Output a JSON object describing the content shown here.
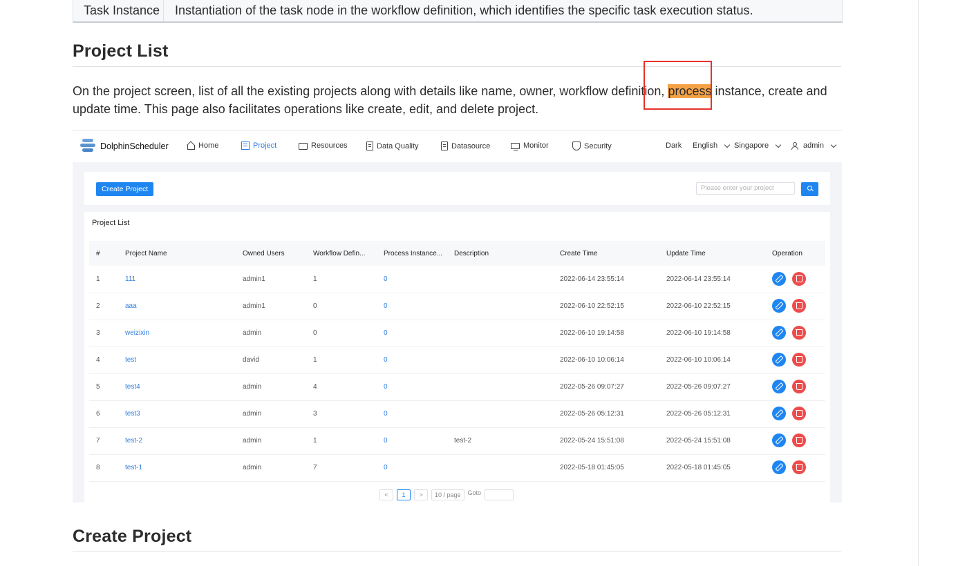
{
  "doc": {
    "task_row": {
      "term": "Task Instance",
      "definition": "Instantiation of the task node in the workflow definition, which identifies the specific task execution status."
    },
    "section1_title": "Project List",
    "para_before": "On the project screen, list of all the existing projects along with details like name, owner, workflow definition, ",
    "para_highlight": "process",
    "para_after": " instance, create and update time. This page also facilitates operations like create, edit, and delete project.",
    "section2_title": "Create Project"
  },
  "app": {
    "brand": "DolphinScheduler",
    "nav": [
      "Home",
      "Project",
      "Resources",
      "Data Quality",
      "Datasource",
      "Monitor",
      "Security"
    ],
    "active_nav": "Project",
    "theme": "Dark",
    "language": "English",
    "timezone": "Singapore",
    "user": "admin",
    "create_button": "Create Project",
    "search_placeholder": "Please enter your project",
    "list_title": "Project List",
    "columns": [
      "#",
      "Project Name",
      "Owned Users",
      "Workflow Defin...",
      "Process Instance...",
      "Description",
      "Create Time",
      "Update Time",
      "Operation"
    ],
    "rows": [
      {
        "idx": "1",
        "name": "111",
        "owner": "admin1",
        "workflows": "1",
        "instances": "0",
        "description": "",
        "create": "2022-06-14 23:55:14",
        "update": "2022-06-14 23:55:14"
      },
      {
        "idx": "2",
        "name": "aaa",
        "owner": "admin1",
        "workflows": "0",
        "instances": "0",
        "description": "",
        "create": "2022-06-10 22:52:15",
        "update": "2022-06-10 22:52:15"
      },
      {
        "idx": "3",
        "name": "weizixin",
        "owner": "admin",
        "workflows": "0",
        "instances": "0",
        "description": "",
        "create": "2022-06-10 19:14:58",
        "update": "2022-06-10 19:14:58"
      },
      {
        "idx": "4",
        "name": "test",
        "owner": "david",
        "workflows": "1",
        "instances": "0",
        "description": "",
        "create": "2022-06-10 10:06:14",
        "update": "2022-06-10 10:06:14"
      },
      {
        "idx": "5",
        "name": "test4",
        "owner": "admin",
        "workflows": "4",
        "instances": "0",
        "description": "",
        "create": "2022-05-26 09:07:27",
        "update": "2022-05-26 09:07:27"
      },
      {
        "idx": "6",
        "name": "test3",
        "owner": "admin",
        "workflows": "3",
        "instances": "0",
        "description": "",
        "create": "2022-05-26 05:12:31",
        "update": "2022-05-26 05:12:31"
      },
      {
        "idx": "7",
        "name": "test-2",
        "owner": "admin",
        "workflows": "1",
        "instances": "0",
        "description": "test-2",
        "create": "2022-05-24 15:51:08",
        "update": "2022-05-24 15:51:08"
      },
      {
        "idx": "8",
        "name": "test-1",
        "owner": "admin",
        "workflows": "7",
        "instances": "0",
        "description": "",
        "create": "2022-05-18 01:45:05",
        "update": "2022-05-18 01:45:05"
      }
    ],
    "pager": {
      "prev": "<",
      "current": "1",
      "next": ">",
      "page_size": "10 / page",
      "goto": "Goto"
    }
  },
  "colors": {
    "accent": "#1f86f1",
    "danger": "#ef4b4b",
    "highlight": "#f5a246",
    "annotation": "#e8322a"
  }
}
